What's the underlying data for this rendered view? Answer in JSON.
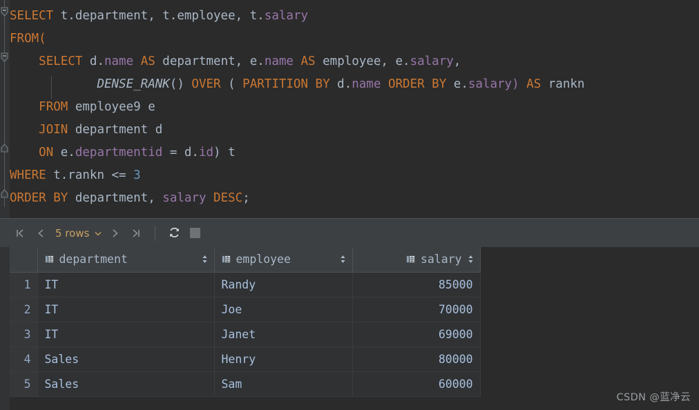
{
  "editor": {
    "language": "sql",
    "colors": {
      "background": "#2B2B2B",
      "keyword": "#CC7832",
      "identifier": "#A9B7C6",
      "column": "#9876AA",
      "number": "#6897BB"
    },
    "lines": [
      {
        "index": 1,
        "fold": "collapse",
        "tokens": [
          {
            "t": "SELECT",
            "k": "kw"
          },
          {
            "t": " t.",
            "k": "id"
          },
          {
            "t": "department",
            "k": "id"
          },
          {
            "t": ", t.",
            "k": "id"
          },
          {
            "t": "employee",
            "k": "id"
          },
          {
            "t": ", t.",
            "k": "id"
          },
          {
            "t": "salary",
            "k": "col"
          }
        ]
      },
      {
        "index": 2,
        "fold": "none",
        "tokens": [
          {
            "t": "FROM",
            "k": "kw"
          },
          {
            "t": "(",
            "k": "kw"
          }
        ]
      },
      {
        "index": 3,
        "fold": "collapse",
        "tokens": [
          {
            "t": "    ",
            "k": "id"
          },
          {
            "t": "SELECT",
            "k": "kw"
          },
          {
            "t": " d.",
            "k": "id"
          },
          {
            "t": "name",
            "k": "col"
          },
          {
            "t": " ",
            "k": "id"
          },
          {
            "t": "AS",
            "k": "kw"
          },
          {
            "t": " department, e.",
            "k": "id"
          },
          {
            "t": "name",
            "k": "col"
          },
          {
            "t": " ",
            "k": "id"
          },
          {
            "t": "AS",
            "k": "kw"
          },
          {
            "t": " employee, e.",
            "k": "id"
          },
          {
            "t": "salary",
            "k": "col"
          },
          {
            "t": ",",
            "k": "id"
          }
        ]
      },
      {
        "index": 4,
        "fold": "none",
        "tokens": [
          {
            "t": "            ",
            "k": "id"
          },
          {
            "t": "DENSE_RANK",
            "k": "fn"
          },
          {
            "t": "() ",
            "k": "id"
          },
          {
            "t": "OVER",
            "k": "kw"
          },
          {
            "t": " ( ",
            "k": "id"
          },
          {
            "t": "PARTITION",
            "k": "kw"
          },
          {
            "t": " ",
            "k": "id"
          },
          {
            "t": "BY",
            "k": "kw"
          },
          {
            "t": " d.",
            "k": "id"
          },
          {
            "t": "name",
            "k": "col"
          },
          {
            "t": " ",
            "k": "id"
          },
          {
            "t": "ORDER",
            "k": "kw"
          },
          {
            "t": " ",
            "k": "id"
          },
          {
            "t": "BY",
            "k": "kw"
          },
          {
            "t": " e.",
            "k": "id"
          },
          {
            "t": "salary",
            "k": "col"
          },
          {
            "t": ") ",
            "k": "col"
          },
          {
            "t": "AS",
            "k": "kw"
          },
          {
            "t": " rankn",
            "k": "id"
          }
        ]
      },
      {
        "index": 5,
        "fold": "none",
        "tokens": [
          {
            "t": "    ",
            "k": "id"
          },
          {
            "t": "FROM",
            "k": "kw"
          },
          {
            "t": " employee9 e",
            "k": "id"
          }
        ]
      },
      {
        "index": 6,
        "fold": "none",
        "tokens": [
          {
            "t": "    ",
            "k": "id"
          },
          {
            "t": "JOIN",
            "k": "kw"
          },
          {
            "t": " department d",
            "k": "id"
          }
        ]
      },
      {
        "index": 7,
        "fold": "end",
        "tokens": [
          {
            "t": "    ",
            "k": "id"
          },
          {
            "t": "ON",
            "k": "kw"
          },
          {
            "t": " e.",
            "k": "id"
          },
          {
            "t": "departmentid",
            "k": "col"
          },
          {
            "t": " = d.",
            "k": "id"
          },
          {
            "t": "id",
            "k": "col"
          },
          {
            "t": ") t",
            "k": "id"
          }
        ]
      },
      {
        "index": 8,
        "fold": "none",
        "tokens": [
          {
            "t": "WHERE",
            "k": "kw"
          },
          {
            "t": " t.rankn <= ",
            "k": "id"
          },
          {
            "t": "3",
            "k": "num"
          }
        ]
      },
      {
        "index": 9,
        "fold": "end",
        "tokens": [
          {
            "t": "ORDER",
            "k": "kw"
          },
          {
            "t": " ",
            "k": "id"
          },
          {
            "t": "BY",
            "k": "kw"
          },
          {
            "t": " department, ",
            "k": "id"
          },
          {
            "t": "salary",
            "k": "col"
          },
          {
            "t": " ",
            "k": "id"
          },
          {
            "t": "DESC",
            "k": "kw"
          },
          {
            "t": ";",
            "k": "id"
          }
        ]
      }
    ]
  },
  "results": {
    "toolbar": {
      "first_page_label": "|<",
      "prev_page_label": "<",
      "rows_label": "5 rows",
      "next_page_label": ">",
      "last_page_label": ">|",
      "refresh_label": "Refresh",
      "stop_label": "Stop"
    },
    "columns": [
      {
        "key": "department",
        "label": "department",
        "align": "left"
      },
      {
        "key": "employee",
        "label": "employee",
        "align": "left"
      },
      {
        "key": "salary",
        "label": "salary",
        "align": "right"
      }
    ],
    "rows": [
      {
        "n": "1",
        "department": "IT",
        "employee": "Randy",
        "salary": "85000"
      },
      {
        "n": "2",
        "department": "IT",
        "employee": "Joe",
        "salary": "70000"
      },
      {
        "n": "3",
        "department": "IT",
        "employee": "Janet",
        "salary": "69000"
      },
      {
        "n": "4",
        "department": "Sales",
        "employee": "Henry",
        "salary": "80000"
      },
      {
        "n": "5",
        "department": "Sales",
        "employee": "Sam",
        "salary": "60000"
      }
    ]
  },
  "watermark": {
    "text": "CSDN @蓝净云"
  }
}
